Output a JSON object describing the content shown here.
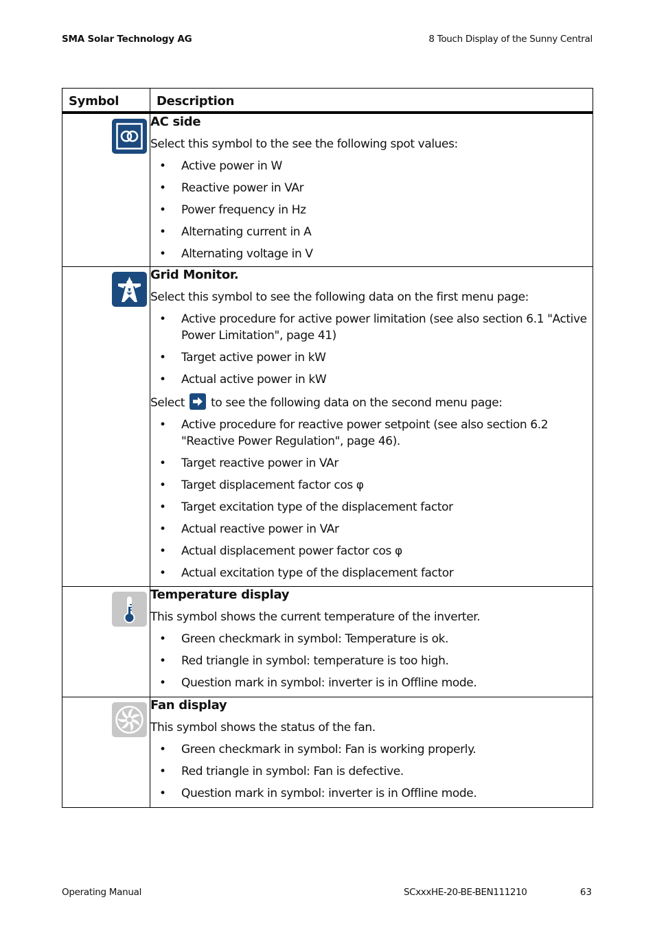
{
  "page_header": {
    "company": "SMA Solar Technology AG",
    "chapter": "8  Touch Display of the Sunny Central"
  },
  "table": {
    "headers": {
      "symbol": "Symbol",
      "description": "Description"
    },
    "rows": [
      {
        "icon": "ac-side-icon",
        "title": "AC side",
        "intro": "Select this symbol to the see the following spot values:",
        "items": [
          "Active power in W",
          "Reactive power in VAr",
          "Power frequency in Hz",
          "Alternating current in A",
          "Alternating voltage in V"
        ]
      },
      {
        "icon": "grid-monitor-icon",
        "title": "Grid Monitor.",
        "intro": "Select this symbol to see the following data on the first menu page:",
        "items": [
          "Active procedure for active power limitation (see also section 6.1 \"Active Power Limitation\", page 41)",
          "Target active power in kW",
          "Actual active power in kW"
        ],
        "second_intro_before": "Select",
        "second_intro_icon": "arrow-right-icon",
        "second_intro_after": "to see the following data on the second menu page:",
        "second_items": [
          "Active procedure for reactive power setpoint (see also section 6.2 \"Reactive Power Regulation\", page 46).",
          "Target reactive power in VAr",
          "Target displacement factor cos φ",
          "Target excitation type of the displacement factor",
          "Actual reactive power in VAr",
          "Actual displacement power factor cos φ",
          "Actual excitation type of the displacement factor"
        ]
      },
      {
        "icon": "thermometer-icon",
        "title": "Temperature display",
        "intro": "This symbol shows the current temperature of the inverter.",
        "items": [
          "Green checkmark in symbol: Temperature is ok.",
          "Red triangle in symbol: temperature is too high.",
          "Question mark in symbol: inverter is in Offline mode."
        ]
      },
      {
        "icon": "fan-icon",
        "title": "Fan display",
        "intro": "This symbol shows the status of the fan.",
        "items": [
          "Green checkmark in symbol: Fan is working properly.",
          "Red triangle in symbol: Fan is defective.",
          "Question mark in symbol: inverter is in Offline mode."
        ]
      }
    ]
  },
  "page_footer": {
    "doc_type": "Operating Manual",
    "doc_id": "SCxxxHE-20-BE-BEN111210",
    "page_number": "63"
  },
  "colors": {
    "icon_blue": "#1b4a7e",
    "icon_grey": "#c7c7c7"
  }
}
